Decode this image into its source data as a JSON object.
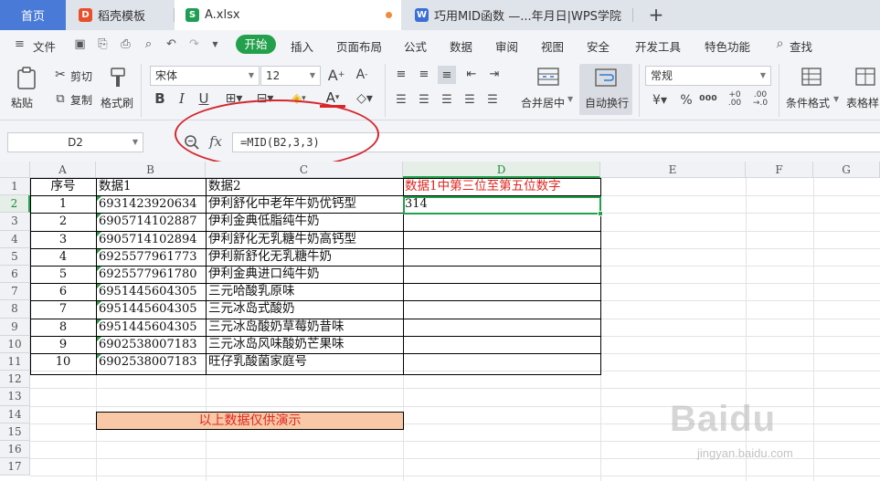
{
  "tabs": [
    {
      "label": "首页"
    },
    {
      "label": "稻壳模板"
    },
    {
      "label": "A.xlsx"
    },
    {
      "label": "巧用MID函数 —...年月日|WPS学院"
    }
  ],
  "menu": {
    "file": "文件",
    "start": "开始",
    "items": [
      "插入",
      "页面布局",
      "公式",
      "数据",
      "审阅",
      "视图",
      "安全",
      "开发工具",
      "特色功能"
    ],
    "search": "查找"
  },
  "ribbon": {
    "paste": "粘贴",
    "cut": "剪切",
    "copy": "复制",
    "format_painter": "格式刷",
    "font_name": "宋体",
    "font_size": "12",
    "merge_center": "合并居中",
    "wrap_text": "自动换行",
    "number_format": "常规",
    "conditional_format": "条件格式",
    "table_style": "表格样"
  },
  "formula_bar": {
    "name_box": "D2",
    "fx": "fx",
    "formula": "=MID(B2,3,3)"
  },
  "sheet": {
    "columns": [
      "A",
      "B",
      "C",
      "D",
      "E",
      "F",
      "G"
    ],
    "rows": [
      "1",
      "2",
      "3",
      "4",
      "5",
      "6",
      "7",
      "8",
      "9",
      "10",
      "11",
      "12",
      "13",
      "14",
      "15",
      "16",
      "17"
    ],
    "header": [
      "序号",
      "数据1",
      "数据2",
      "数据1中第三位至第五位数字"
    ],
    "data": [
      [
        "1",
        "6931423920634",
        "伊利舒化中老年牛奶优钙型",
        "314"
      ],
      [
        "2",
        "6905714102887",
        "伊利金典低脂纯牛奶",
        ""
      ],
      [
        "3",
        "6905714102894",
        "伊利舒化无乳糖牛奶高钙型",
        ""
      ],
      [
        "4",
        "6925577961773",
        "伊利新舒化无乳糖牛奶",
        ""
      ],
      [
        "5",
        "6925577961780",
        "伊利金典进口纯牛奶",
        ""
      ],
      [
        "6",
        "6951445604305",
        "三元哈酸乳原味",
        ""
      ],
      [
        "7",
        "6951445604305",
        "三元冰岛式酸奶",
        ""
      ],
      [
        "8",
        "6951445604305",
        "三元冰岛酸奶草莓奶昔味",
        ""
      ],
      [
        "9",
        "6902538007183",
        "三元冰岛风味酸奶芒果味",
        ""
      ],
      [
        "10",
        "6902538007183",
        "旺仔乳酸菌家庭号",
        ""
      ]
    ],
    "note": "以上数据仅供演示",
    "header_color": "#e0251f",
    "accent": "#23a04b"
  },
  "watermark": {
    "brand": "Baidu",
    "url": "jingyan.baidu.com"
  }
}
